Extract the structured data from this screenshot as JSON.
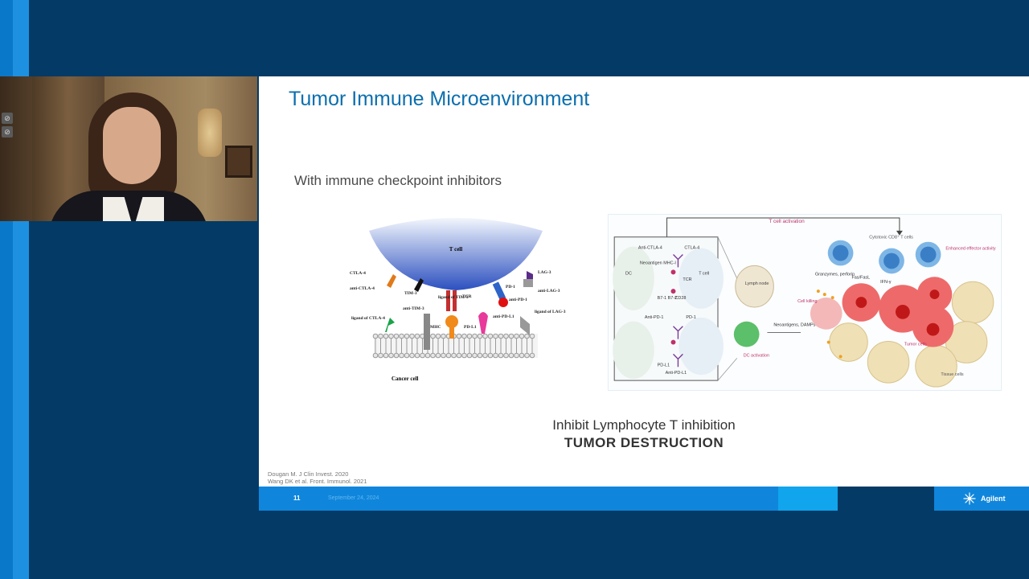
{
  "slide": {
    "title": "Tumor Immune Microenvironment",
    "subtitle": "With immune checkpoint inhibitors",
    "caption_line1": "Inhibit Lymphocyte T inhibition",
    "caption_line2": "TUMOR DESTRUCTION",
    "references": [
      "Dougan M. J Clin Invest. 2020",
      "Wang DK et al. Front. Immunol. 2021"
    ],
    "page_number": "11",
    "date": "September 24, 2024",
    "logo": "Agilent"
  },
  "figure_left": {
    "labels": {
      "t_cell": "T cell",
      "cancer_cell": "Cancer cell",
      "ctla4": "CTLA-4",
      "anti_ctla4": "anti-CTLA-4",
      "ligand_ctla4": "ligand of CTLA-4",
      "tim3": "TIM-3",
      "anti_tim3": "anti-TIM-3",
      "ligand_tim3": "ligand of TIM-3",
      "tcr": "TCR",
      "mhc": "MHC",
      "pd1": "PD-1",
      "anti_pd1": "anti-PD-1",
      "pdl1": "PD-L1",
      "anti_pdl1": "anti-PD-L1",
      "lag3": "LAG-3",
      "anti_lag3": "anti-LAG-3",
      "ligand_lag3": "ligand of LAG-3"
    }
  },
  "figure_right": {
    "labels": {
      "t_cell_activation": "T cell activation",
      "cytotoxic": "Cytotoxic CD8⁺ T cells",
      "enhanced": "Enhanced effector activity",
      "anti_ctla4": "Anti-CTLA-4",
      "ctla4": "CTLA-4",
      "neoantigen": "Neoantigen MHC-I",
      "tcr": "TCR",
      "t_cell": "T cell",
      "dc": "DC",
      "b7": "B7-1 B7-2",
      "cd28": "CD28",
      "anti_pd1": "Anti-PD-1",
      "pd1": "PD-1",
      "pdl1": "PD-L1",
      "anti_pdl1": "Anti-PD-L1",
      "lymph_node": "Lymph node",
      "dc_activation": "DC activation",
      "neoantigens_damps": "Neoantigens, DAMPs",
      "granzymes": "Granzymes, perforin",
      "fas": "Fas/FasL",
      "ifn": "IFN-γ",
      "cell_killing": "Cell killing",
      "tumor_cells": "Tumor cells",
      "tissue_cells": "Tissue cells"
    }
  }
}
